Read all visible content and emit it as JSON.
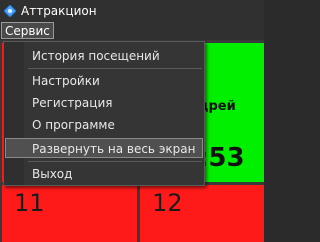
{
  "window": {
    "title": "Аттракцион"
  },
  "menubar": {
    "service_label": "Сервис"
  },
  "tiles": {
    "top_left_number": "",
    "green_name": "дрей",
    "green_time": ":53",
    "bottom_left_number": "11",
    "bottom_right_number": "12"
  },
  "dropdown": {
    "items": [
      {
        "label": "История посещений"
      },
      {
        "label": "Настройки"
      },
      {
        "label": "Регистрация"
      },
      {
        "label": "О программе"
      },
      {
        "label": "Развернуть на весь экран"
      },
      {
        "label": "Выход"
      }
    ],
    "selected_index": 4
  },
  "colors": {
    "green_tile": "#00f000",
    "red_tile": "#ff1a1a",
    "window_bg": "#303030"
  }
}
